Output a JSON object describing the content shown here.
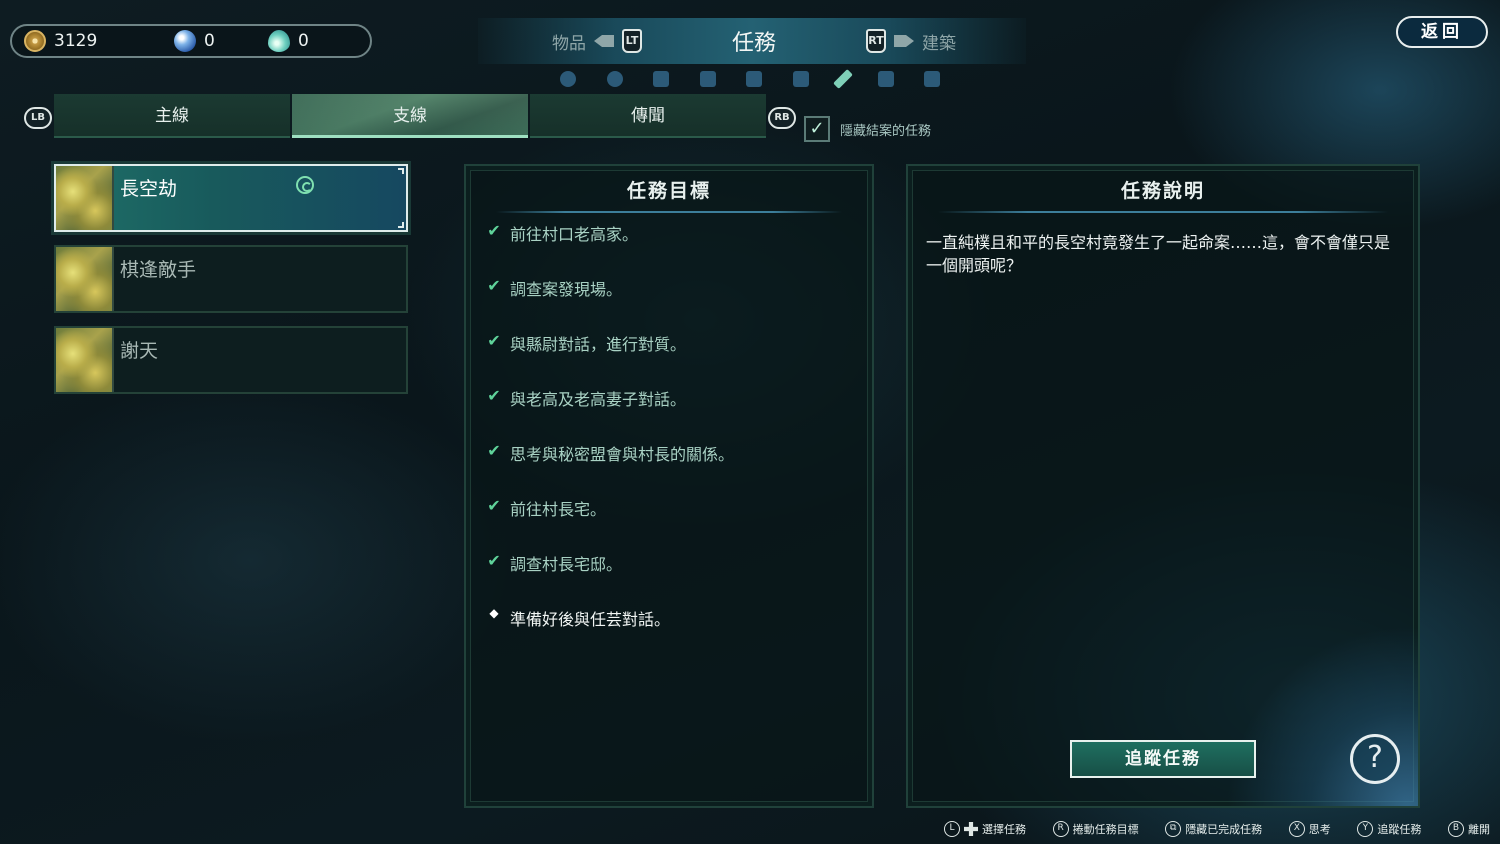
{
  "currency": [
    {
      "icon": "coin-icon",
      "value": "3129"
    },
    {
      "icon": "blue-orb-icon",
      "value": "0"
    },
    {
      "icon": "water-drop-icon",
      "value": "0"
    }
  ],
  "top_tabs": {
    "left": {
      "label": "物品",
      "button": "LT"
    },
    "center": {
      "label": "任務"
    },
    "right": {
      "label": "建築",
      "button": "RT"
    }
  },
  "category_icons": [
    "mask-icon",
    "spiral-icon",
    "book-icon",
    "figure-icon",
    "armor-icon",
    "chest-icon",
    "brush-icon",
    "table-icon",
    "scroll-icon"
  ],
  "back_label": "返回",
  "sub_tabs": {
    "left_button": "LB",
    "right_button": "RB",
    "tabs": [
      {
        "label": "主線"
      },
      {
        "label": "支線"
      },
      {
        "label": "傳聞"
      }
    ]
  },
  "hide_closed": {
    "label": "隱藏結案的任務",
    "checked": true
  },
  "quests": [
    {
      "name": "長空劫",
      "selected": true,
      "tracked_icon": "swirl-icon"
    },
    {
      "name": "棋逢敵手",
      "selected": false
    },
    {
      "name": "謝天",
      "selected": false
    }
  ],
  "objectives_panel": {
    "title": "任務目標",
    "items": [
      {
        "text": "前往村口老高家。",
        "status": "done"
      },
      {
        "text": "調查案發現場。",
        "status": "done"
      },
      {
        "text": "與縣尉對話，進行對質。",
        "status": "done"
      },
      {
        "text": "與老高及老高妻子對話。",
        "status": "done"
      },
      {
        "text": "思考與秘密盟會與村長的關係。",
        "status": "done"
      },
      {
        "text": "前往村長宅。",
        "status": "done"
      },
      {
        "text": "調查村長宅邸。",
        "status": "done"
      },
      {
        "text": "準備好後與任芸對話。",
        "status": "pending"
      }
    ]
  },
  "description_panel": {
    "title": "任務說明",
    "text": "一直純樸且和平的長空村竟發生了一起命案……這，會不會僅只是一個開頭呢？"
  },
  "track_button": "追蹤任務",
  "hints": [
    {
      "glyph": "L",
      "label": "選擇任務"
    },
    {
      "glyph": "R",
      "label": "捲動任務目標"
    },
    {
      "glyph": "⧉",
      "label": "隱藏已完成任務"
    },
    {
      "glyph": "X",
      "label": "思考"
    },
    {
      "glyph": "Y",
      "label": "追蹤任務"
    },
    {
      "glyph": "B",
      "label": "離開"
    }
  ]
}
